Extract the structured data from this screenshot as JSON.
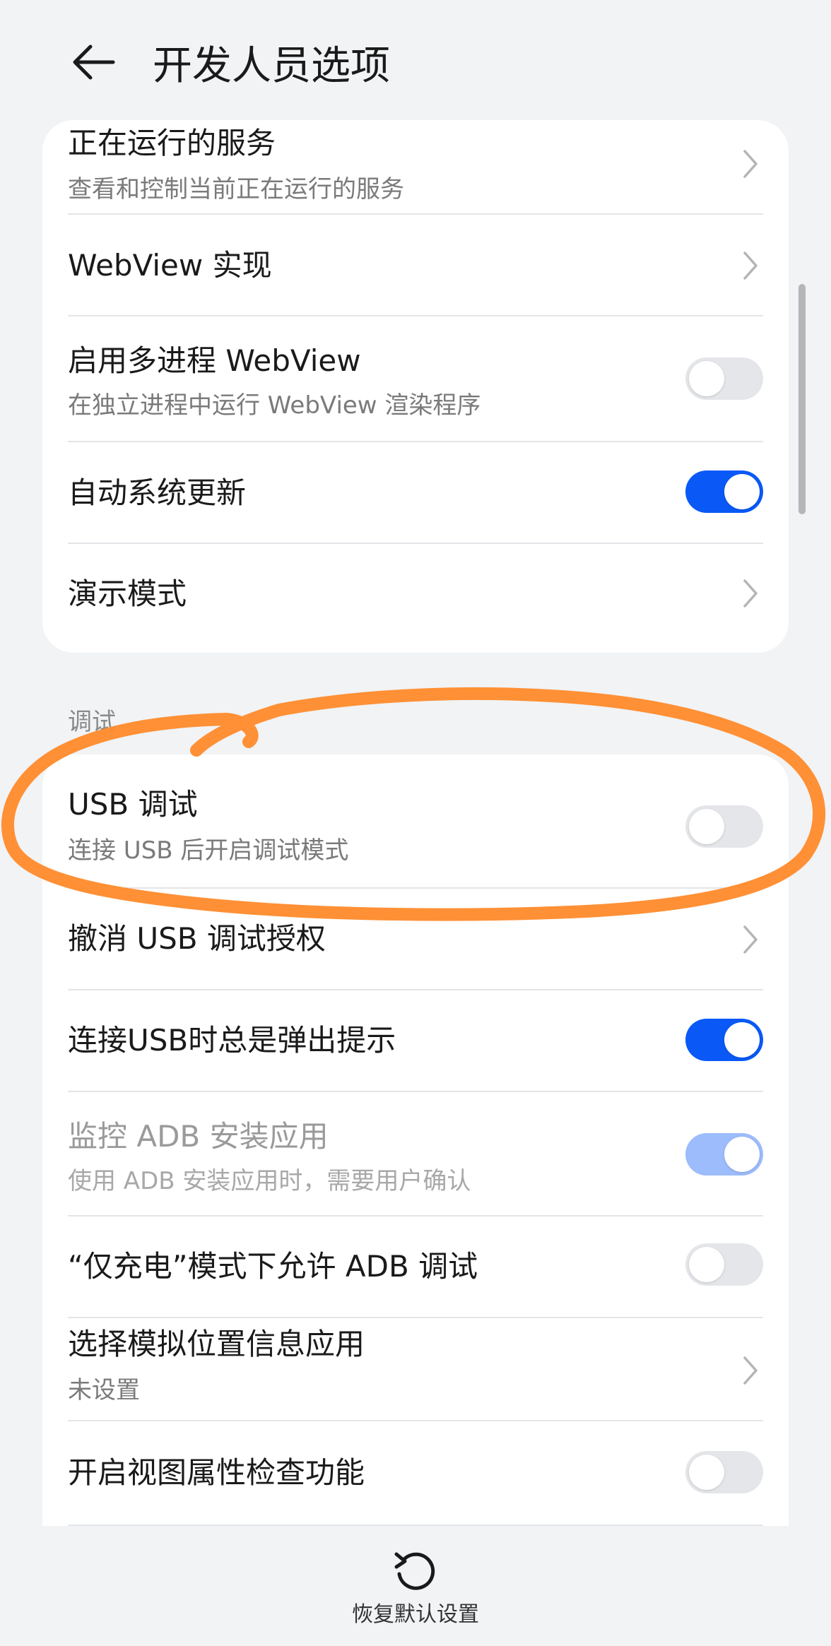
{
  "header": {
    "title": "开发人员选项",
    "back_icon": "arrow-left-icon"
  },
  "card_top": {
    "items": [
      {
        "title": "正在运行的服务",
        "subtitle": "查看和控制当前正在运行的服务",
        "control": "chevron"
      },
      {
        "title": "WebView 实现",
        "control": "chevron"
      },
      {
        "title": "启用多进程 WebView",
        "subtitle": "在独立进程中运行 WebView 渲染程序",
        "control": "toggle",
        "checked": false
      },
      {
        "title": "自动系统更新",
        "control": "toggle",
        "checked": true
      },
      {
        "title": "演示模式",
        "control": "chevron"
      }
    ]
  },
  "section_debug": {
    "label": "调试",
    "items": [
      {
        "title": "USB 调试",
        "subtitle": "连接 USB 后开启调试模式",
        "control": "toggle",
        "checked": false
      },
      {
        "title": "撤消 USB 调试授权",
        "control": "chevron"
      },
      {
        "title": "连接USB时总是弹出提示",
        "control": "toggle",
        "checked": true
      },
      {
        "title": "监控 ADB 安装应用",
        "subtitle": "使用 ADB 安装应用时，需要用户确认",
        "control": "toggle",
        "checked": true,
        "disabled": true
      },
      {
        "title": "“仅充电”模式下允许 ADB 调试",
        "control": "toggle",
        "checked": false
      },
      {
        "title": "选择模拟位置信息应用",
        "subtitle": "未设置",
        "control": "chevron"
      },
      {
        "title": "开启视图属性检查功能",
        "control": "toggle",
        "checked": false
      }
    ]
  },
  "bottom": {
    "reset_label": "恢复默认设置",
    "reset_icon": "refresh-icon"
  },
  "colors": {
    "accent": "#0a59f7",
    "accent_disabled": "#9cbcfb",
    "annotation": "#ff8a2a",
    "background": "#f1f3f5"
  }
}
